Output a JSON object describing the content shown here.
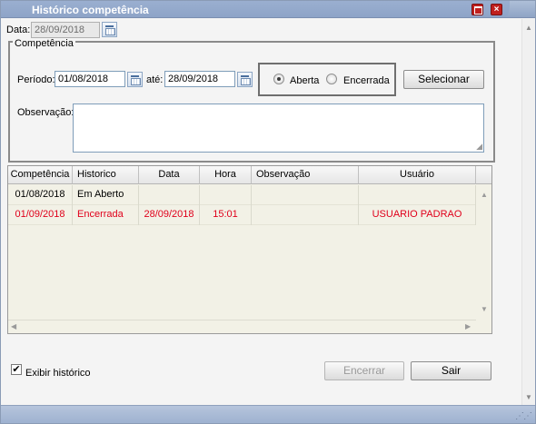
{
  "window": {
    "title": "Histórico competência"
  },
  "top": {
    "date_label": "Data:",
    "date_value": "28/09/2018"
  },
  "group": {
    "legend": "Competência",
    "period_label": "Período:",
    "period_from": "01/08/2018",
    "until_label": "até:",
    "period_to": "28/09/2018",
    "radio_open": "Aberta",
    "radio_closed": "Encerrada",
    "select_button": "Selecionar",
    "observation_label": "Observação:"
  },
  "table": {
    "columns": [
      "Competência",
      "Historico",
      "Data",
      "Hora",
      "Observação",
      "Usuário"
    ],
    "rows": [
      {
        "competencia": "01/08/2018",
        "historico": "Em Aberto",
        "data": "",
        "hora": "",
        "observacao": "",
        "usuario": ""
      },
      {
        "competencia": "01/09/2018",
        "historico": "Encerrada",
        "data": "28/09/2018",
        "hora": "15:01",
        "observacao": "",
        "usuario": "USUARIO PADRAO"
      }
    ]
  },
  "footer": {
    "show_history_label": "Exibir histórico",
    "close_button": "Encerrar",
    "exit_button": "Sair"
  },
  "colors": {
    "title_bar": "#8fa4c5",
    "closed_row_text": "#e0001b",
    "grid_background": "#f2f1e6"
  }
}
